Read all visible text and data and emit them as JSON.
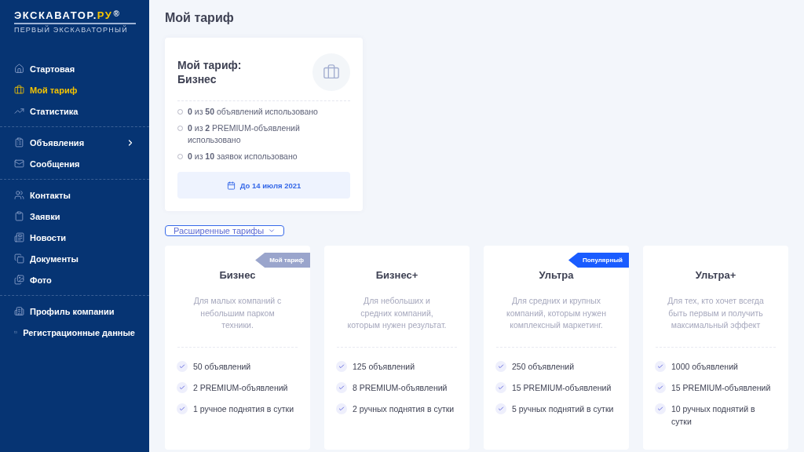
{
  "logo": {
    "name": "ЭКСКАВАТОР.",
    "accent": "РУ",
    "mark": "®",
    "tagline": "ПЕРВЫЙ ЭКСКАВАТОРНЫЙ"
  },
  "sidebar": {
    "groups": [
      {
        "items": [
          {
            "label": "Стартовая",
            "selected": false
          },
          {
            "label": "Мой тариф",
            "selected": true
          },
          {
            "label": "Статистика",
            "selected": false
          }
        ]
      },
      {
        "items": [
          {
            "label": "Объявления",
            "selected": false,
            "has_submenu": true
          },
          {
            "label": "Сообщения",
            "selected": false
          }
        ]
      },
      {
        "items": [
          {
            "label": "Контакты",
            "selected": false
          },
          {
            "label": "Заявки",
            "selected": false
          },
          {
            "label": "Новости",
            "selected": false
          },
          {
            "label": "Документы",
            "selected": false
          },
          {
            "label": "Фото",
            "selected": false
          }
        ]
      },
      {
        "items": [
          {
            "label": "Профиль компании",
            "selected": false
          },
          {
            "label": "Регистрационные данные",
            "selected": false
          }
        ]
      }
    ]
  },
  "page_title": "Мой тариф",
  "current_plan": {
    "title": "Мой тариф:",
    "name": "Бизнес",
    "usage": [
      "**0** из **50** объявлений использовано",
      "**0** из **2** PREMIUM-объявлений использовано",
      "**0** из **10** заявок использовано"
    ],
    "valid_until": "До 14 июля 2021"
  },
  "extended_button": "Расширенные тарифы",
  "plans": [
    {
      "name": "Бизнес",
      "ribbon": {
        "label": "Мой тариф",
        "kind": "current"
      },
      "description": "Для малых компаний с небольшим парком техники.",
      "features": [
        "50 объявлений",
        "2 PREMIUM-объявлений",
        "1 ручное поднятия в сутки"
      ]
    },
    {
      "name": "Бизнес+",
      "description": "Для небольших и средних компаний, которым нужен результат.",
      "features": [
        "125 объявлений",
        "8 PREMIUM-объявлений",
        "2 ручных поднятия в сутки"
      ]
    },
    {
      "name": "Ультра",
      "ribbon": {
        "label": "Популярный",
        "kind": "popular"
      },
      "description": "Для средних и крупных компаний, которым нужен комплексный маркетинг.",
      "features": [
        "250 объявлений",
        "15 PREMIUM-объявлений",
        "5 ручных поднятий в сутки"
      ]
    },
    {
      "name": "Ультра+",
      "description": "Для тех, кто хочет всегда быть первым и получить максимальный эффект",
      "features": [
        "1000 объявлений",
        "15 PREMIUM-объявлений",
        "10 ручных поднятий в сутки"
      ]
    }
  ]
}
